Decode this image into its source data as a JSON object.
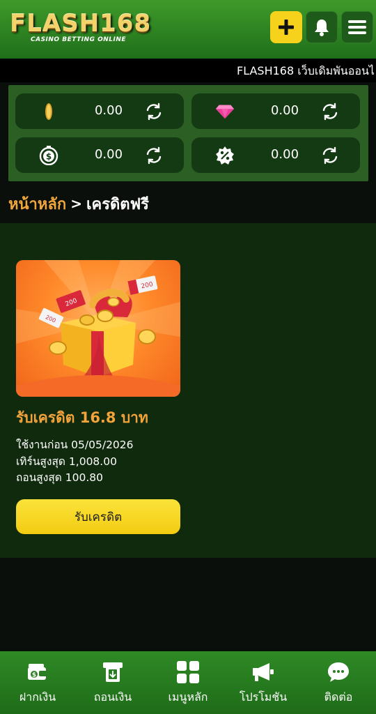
{
  "header": {
    "logo_text": "FLASH168",
    "logo_subtitle": "CASINO BETTING ONLINE",
    "add_icon": "plus-icon",
    "bell_icon": "bell-icon",
    "menu_icon": "hamburger-menu-icon",
    "accent": "#f7d21c"
  },
  "ticker": {
    "text": "FLASH168 เว็บเดิมพันออนไ"
  },
  "wallet": {
    "items": [
      {
        "icon": "coin-icon",
        "value": "0.00"
      },
      {
        "icon": "gem-icon",
        "value": "0.00"
      },
      {
        "icon": "dollar-timer-icon",
        "value": "0.00"
      },
      {
        "icon": "percent-badge-icon",
        "value": "0.00"
      }
    ],
    "refresh_icon": "refresh-icon"
  },
  "breadcrumb": {
    "home": "หน้าหลัก",
    "separator": ">",
    "current": "เครดิตฟรี"
  },
  "promo": {
    "title": "รับเครดิต 16.8 บาท",
    "lines": [
      "ใช้งานก่อน 05/05/2026",
      "เทิร์นสูงสุด 1,008.00",
      "ถอนสูงสุด 100.80"
    ],
    "button_label": "รับเครดิต",
    "ticket_labels": [
      "200",
      "200",
      "200"
    ]
  },
  "bottom_nav": {
    "items": [
      {
        "label": "ฝากเงิน",
        "icon": "wallet-deposit-icon"
      },
      {
        "label": "ถอนเงิน",
        "icon": "withdraw-icon"
      },
      {
        "label": "เมนูหลัก",
        "icon": "grid-menu-icon"
      },
      {
        "label": "โปรโมชัน",
        "icon": "megaphone-icon"
      },
      {
        "label": "ติดต่อ",
        "icon": "chat-support-icon"
      }
    ]
  }
}
